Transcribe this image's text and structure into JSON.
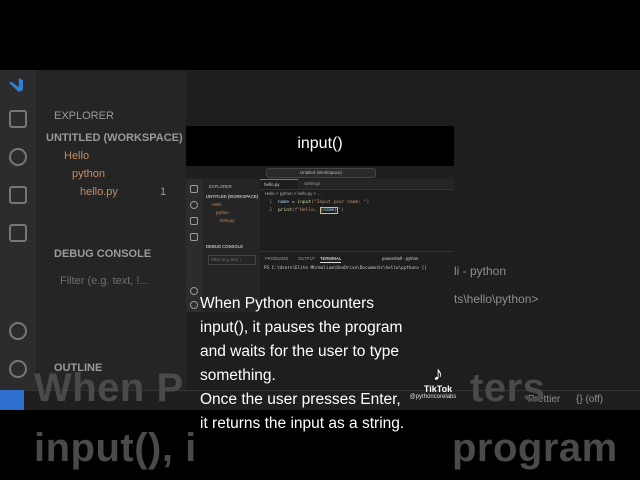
{
  "video": {
    "heading": "input()",
    "caption_lines": [
      "When Python encounters",
      "input(), it pauses the program",
      "and waits for the user to type",
      "something.",
      "Once the user presses Enter,",
      "it returns the input as a string."
    ],
    "shadow_caption_line1": "When P",
    "shadow_caption_line1_end": "ters",
    "shadow_caption_line2": "input(), i",
    "shadow_caption_line2_end": "program"
  },
  "watermark": {
    "logo": "tiktok-logo",
    "name": "TikTok",
    "handle": "@pythoncorelabs"
  },
  "background_vscode": {
    "sidebar_header": "EXPLORER",
    "workspace": "UNTITLED (WORKSPACE)",
    "folder_hello": "Hello",
    "folder_python": "python",
    "file": "hello.py",
    "file_badge": "1",
    "debug_console": "DEBUG CONSOLE",
    "filter_placeholder": "Filter (e.g. text, !...",
    "outline": "OUTLINE",
    "terminal_label": "li - python",
    "terminal_path": "ts\\hello\\python>",
    "status_prettier": "Prettier",
    "status_off": "{} (off)"
  },
  "inner_vscode": {
    "search": "Untitled (Workspace)",
    "explorer": "EXPLORER",
    "workspace": "UNTITLED (WORKSPACE)",
    "folder_hello": "Hello",
    "folder_python": "python",
    "file": "hello.py",
    "debug_console": "DEBUG CONSOLE",
    "filter_placeholder": "Filter (e.g. text, !...",
    "tab_hello": "hello.py",
    "tab_settings": "Settings",
    "breadcrumb": "Hello > python > hello.py > ...",
    "code": [
      {
        "n": "1",
        "a": "name",
        "b": " = ",
        "c": "input",
        "d": "(\"Input your name: \")"
      },
      {
        "n": "2",
        "a": "print",
        "b": "(f\"Hello, ",
        "c": "{name}",
        "d": "\")"
      }
    ],
    "panel_tabs": [
      "PROBLEMS",
      "OUTPUT",
      "TERMINAL"
    ],
    "panel_right": "powershell - python",
    "terminal_line": "PS C:\\Users\\Elite Mhrmalium\\OneDrive\\Documents\\hello\\python> []"
  }
}
